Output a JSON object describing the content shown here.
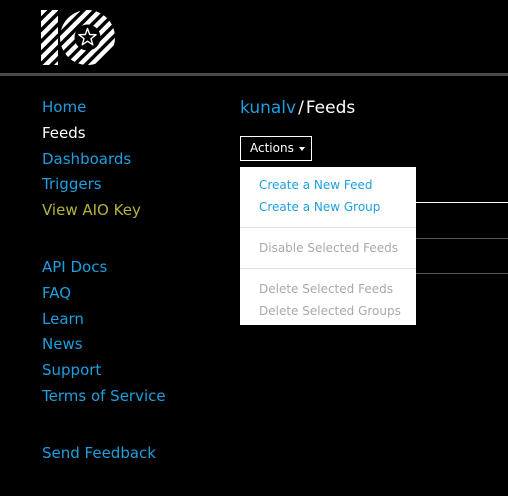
{
  "brand": {
    "logo_icon": "io-logo-icon"
  },
  "sidebar": {
    "primary": [
      {
        "label": "Home"
      },
      {
        "label": "Feeds"
      },
      {
        "label": "Dashboards"
      },
      {
        "label": "Triggers"
      },
      {
        "label": "View AIO Key"
      }
    ],
    "secondary": [
      {
        "label": "API Docs"
      },
      {
        "label": "FAQ"
      },
      {
        "label": "Learn"
      },
      {
        "label": "News"
      },
      {
        "label": "Support"
      },
      {
        "label": "Terms of Service"
      }
    ],
    "feedback": {
      "label": "Send Feedback"
    }
  },
  "breadcrumb": {
    "user": "kunalv",
    "separator": "/",
    "current": "Feeds"
  },
  "actions": {
    "label": "Actions",
    "menu": {
      "group1": [
        "Create a New Feed",
        "Create a New Group"
      ],
      "group2": [
        "Disable Selected Feeds"
      ],
      "group3": [
        "Delete Selected Feeds",
        "Delete Selected Groups"
      ]
    }
  },
  "colors": {
    "background": "#000000",
    "link": "#1e9fe0",
    "active": "#ffffff",
    "aio_key": "#b7b23d",
    "disabled": "#a9a9a9"
  }
}
